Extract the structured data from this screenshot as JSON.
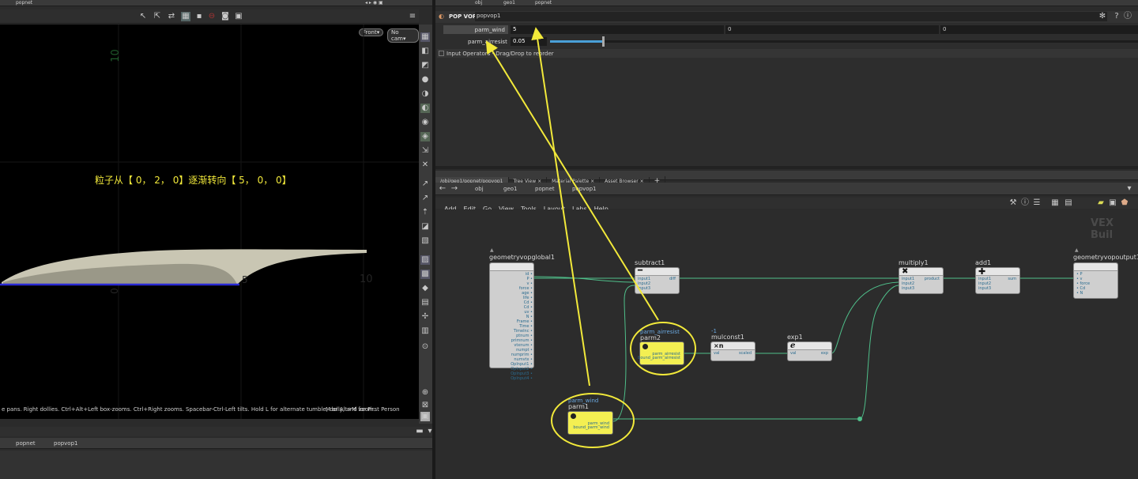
{
  "left_header": {
    "path_label": "popnet"
  },
  "viewport": {
    "front_button": "Front▾",
    "cam_button": "No cam▾",
    "axis_labels": {
      "ten_top": "10",
      "zero_mid": "0",
      "ten_right": "10",
      "five_right": "5"
    },
    "annotation_cn": "粒子从【 0， 2， 0】逐渐转向【 5， 0， 0】",
    "status_hint": "e pans. Right dollies. Ctrl+Alt+Left box-zooms. Ctrl+Right zooms. Spacebar-Ctrl-Left tilts. Hold L for alternate tumble, dolly, and zoom.",
    "status_hint_2": "M or Alt+M for First Person"
  },
  "bottom_left_path": {
    "a": "popnet",
    "b": "popvop1"
  },
  "top_right_path": {
    "a": "obj",
    "b": "geo1",
    "c": "popnet"
  },
  "param_editor": {
    "node_type": "POP VOP",
    "node_name": "popvop1",
    "parm_wind": {
      "label": "parm_wind",
      "value": "5",
      "v2": "0",
      "v3": "0"
    },
    "parm_airresist": {
      "label": "parm_airresist",
      "value": "0.05",
      "slider_fraction": 0.09
    },
    "input_ops": "Input Operators - Drag/Drop to reorder"
  },
  "network_tabs": [
    "/obj/geo1/popnet/popvop1",
    "Tree View",
    "Material Palette",
    "Asset Browser",
    "+"
  ],
  "network_path": {
    "a": "obj",
    "b": "geo1",
    "c": "popnet",
    "d": "popvop1"
  },
  "menu": [
    "Add",
    "Edit",
    "Go",
    "View",
    "Tools",
    "Layout",
    "Labs",
    "Help"
  ],
  "watermark": "VEX Buil",
  "nodes": {
    "geometryvopglobal1": {
      "name": "geometryvopglobal1",
      "ports": [
        "id",
        "P",
        "v",
        "force",
        "age",
        "life",
        "Cd",
        "Cd",
        "uv",
        "N",
        "Frame",
        "Time",
        "TimeInc",
        "ptnum",
        "primnum",
        "vtxnum",
        "numpt",
        "numprim",
        "numvtx",
        "OpInput1",
        "OpInput2",
        "OpInput3",
        "OpInput4"
      ]
    },
    "subtract1": {
      "name": "subtract1",
      "inputs": [
        "input1",
        "input2",
        "input3"
      ],
      "output": "diff"
    },
    "multiply1": {
      "name": "multiply1",
      "inputs": [
        "input1",
        "input2",
        "input3"
      ],
      "output": "product"
    },
    "add1": {
      "name": "add1",
      "inputs": [
        "input1",
        "input2",
        "input3"
      ],
      "output": "sum"
    },
    "geometryvopoutput1": {
      "name": "geometryvopoutput1",
      "ports": [
        "P",
        "v",
        "force",
        "Cd",
        "N"
      ]
    },
    "parm2": {
      "label": "parm_airresist",
      "name": "parm2",
      "out1": "parm_airresist",
      "out2": "bound_parm_airresist"
    },
    "mulconst1": {
      "pre": "-1",
      "name": "mulconst1",
      "glyph": "×n",
      "in": "val",
      "out": "scaled"
    },
    "exp1": {
      "name": "exp1",
      "glyph": "e",
      "in": "val",
      "out": "exp"
    },
    "parm1": {
      "label": "parm_wind",
      "name": "parm1",
      "out1": "parm_wind",
      "out2": "bound_parm_wind"
    }
  },
  "colors": {
    "accent_yellow": "#f2e93a",
    "wire_green": "#4fbf8a",
    "node_yellow": "#f3ef52"
  }
}
